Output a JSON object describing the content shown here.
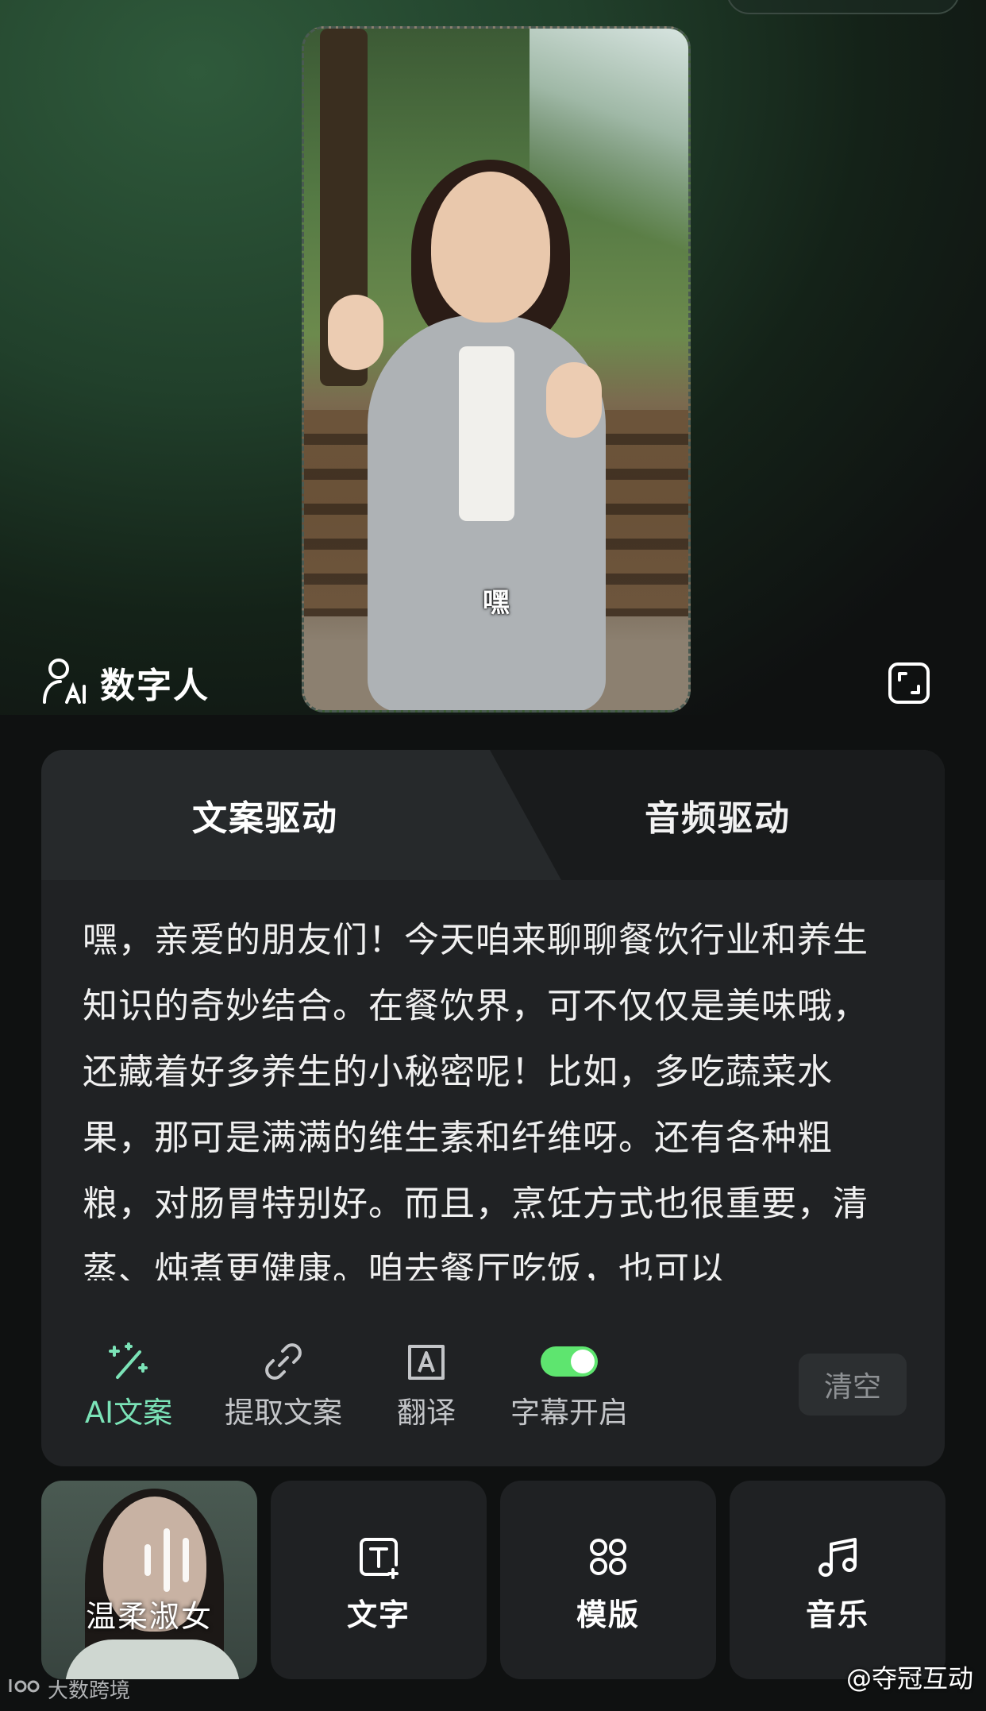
{
  "photo": {
    "caption": "嘿"
  },
  "digital_human": {
    "label": "数字人"
  },
  "tabs": {
    "text_driven": "文案驱动",
    "audio_driven": "音频驱动"
  },
  "script_text": "嘿，亲爱的朋友们！今天咱来聊聊餐饮行业和养生知识的奇妙结合。在餐饮界，可不仅仅是美味哦，还藏着好多养生的小秘密呢！比如，多吃蔬菜水果，那可是满满的维生素和纤维呀。还有各种粗粮，对肠胃特别好。而且，烹饪方式也很重要，清蒸、炖煮更健康。咱去餐厅吃饭，也可以",
  "tools": {
    "ai_copy": "AI文案",
    "extract": "提取文案",
    "translate": "翻译",
    "subtitle": "字幕开启",
    "subtitle_on": true,
    "clear": "清空"
  },
  "cards": {
    "voice": "温柔淑女",
    "text": "文字",
    "template": "模版",
    "music": "音乐"
  },
  "watermarks": {
    "left": "大数跨境",
    "right": "@夺冠互动"
  },
  "colors": {
    "accent_green": "#7be3b7",
    "toggle_green": "#5ee56f"
  }
}
